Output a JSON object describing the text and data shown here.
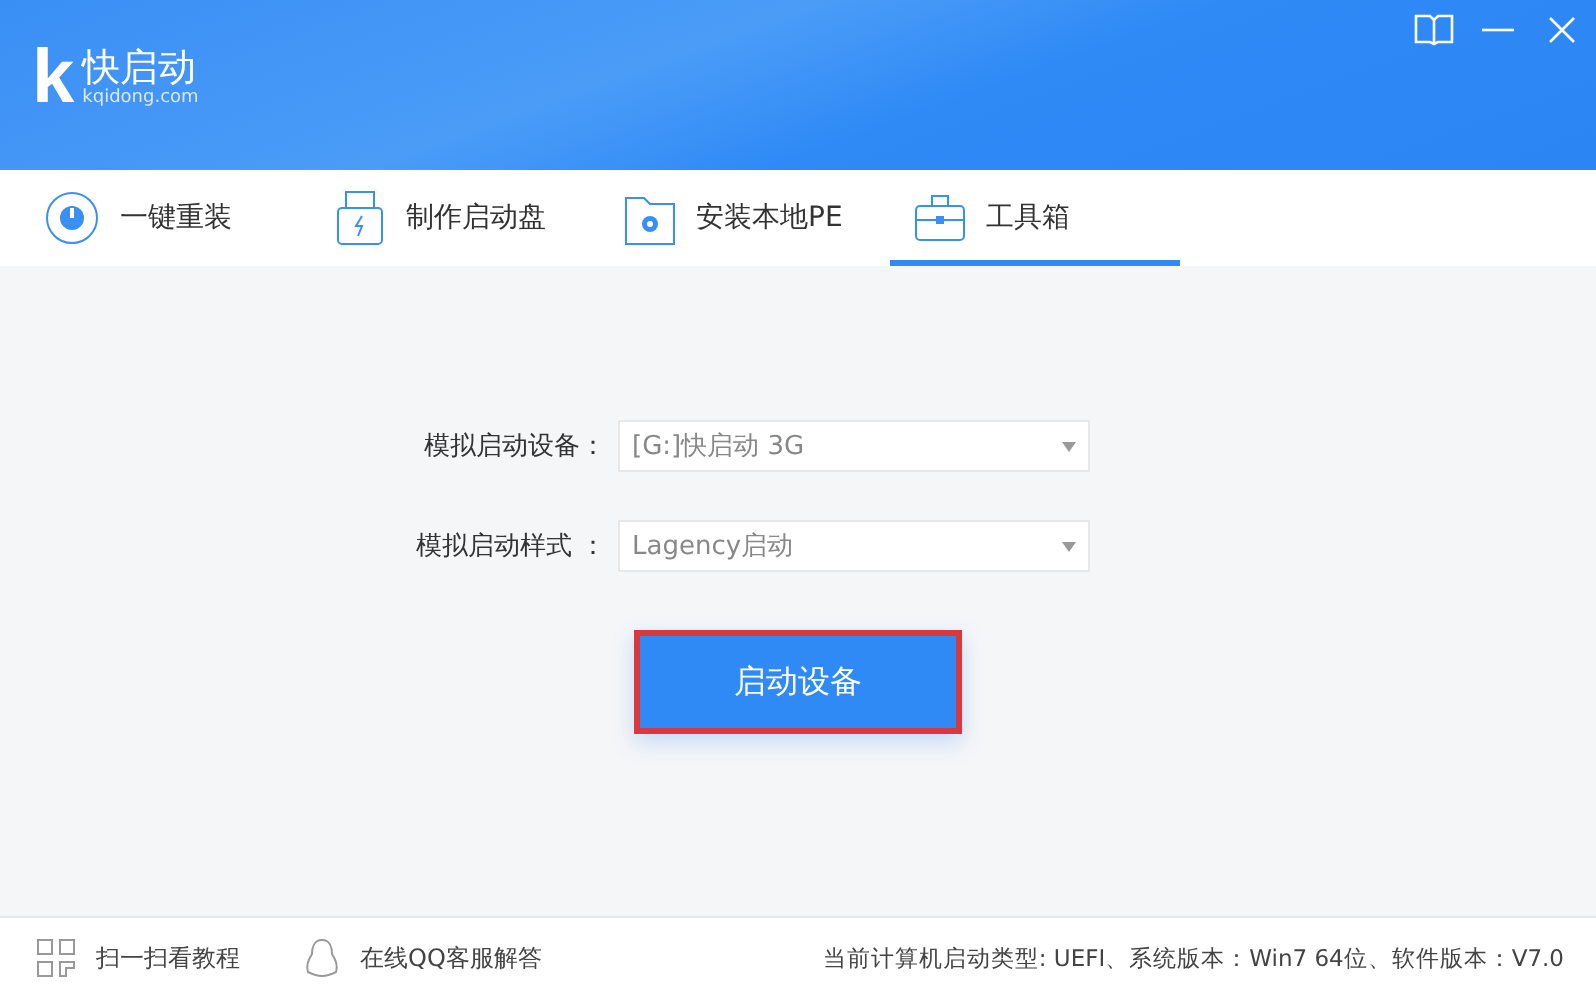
{
  "header": {
    "logo_letter": "k",
    "logo_name": "快启动",
    "logo_domain": "kqidong.com"
  },
  "tabs": [
    {
      "label": "一键重装",
      "kind": "power",
      "selected": false
    },
    {
      "label": "制作启动盘",
      "kind": "usb",
      "selected": false
    },
    {
      "label": "安装本地PE",
      "kind": "folder",
      "selected": false
    },
    {
      "label": "工具箱",
      "kind": "toolbox",
      "selected": true
    }
  ],
  "form": [
    {
      "label": "模拟启动设备：",
      "value": "[G:]快启动 3G"
    },
    {
      "label": "模拟启动样式 ：",
      "value": "Lagency启动"
    }
  ],
  "start_button": {
    "label": "启动设备",
    "highlighted": true
  },
  "footer": {
    "links": [
      {
        "label": "扫一扫看教程",
        "kind": "qr"
      },
      {
        "label": "在线QQ客服解答",
        "kind": "chat"
      }
    ],
    "status": "当前计算机启动类型: UEFI、系统版本：Win7 64位、软件版本：V7.0"
  }
}
